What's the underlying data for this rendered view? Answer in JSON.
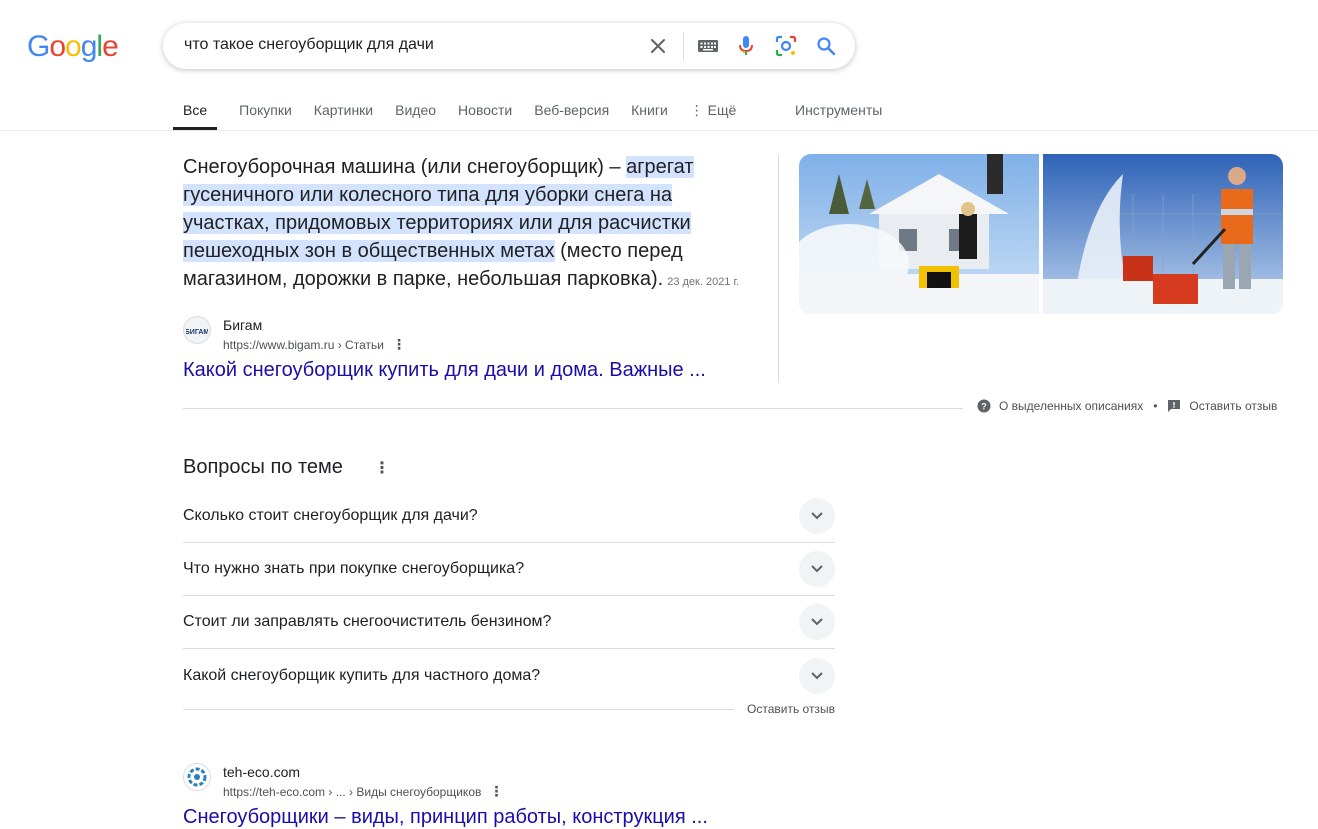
{
  "logo": {
    "letters": [
      "G",
      "o",
      "o",
      "g",
      "l",
      "e"
    ],
    "colors": [
      "#4285F4",
      "#EA4335",
      "#FBBC05",
      "#4285F4",
      "#34A853",
      "#EA4335"
    ]
  },
  "search": {
    "query": "что такое снегоуборщик для дачи",
    "icons": [
      "clear-icon",
      "keyboard-icon",
      "mic-icon",
      "lens-icon",
      "search-icon"
    ]
  },
  "tabs": {
    "items": [
      "Все",
      "Покупки",
      "Картинки",
      "Видео",
      "Новости",
      "Веб-версия",
      "Книги"
    ],
    "active": "Все",
    "more_label": "⋮ Ещё",
    "tools_label": "Инструменты"
  },
  "featured": {
    "text_before": "Снегоуборочная машина (или снегоуборщик) – ",
    "text_highlight": "агрегат гусеничного или колесного типа для уборки снега на участках, придомовых территориях или для расчистки пешеходных зон в общественных метах",
    "text_after": " (место перед магазином, дорожки в парке, небольшая парковка).",
    "date": "23 дек. 2021 г.",
    "source": {
      "favicon_text": "БИГАМ",
      "name": "Бигам",
      "url": "https://www.bigam.ru › Статьи"
    },
    "link_title": "Какой снегоуборщик купить для дачи и дома. Важные ...",
    "footer_about": "О выделенных описаниях",
    "footer_feedback": "Оставить отзыв"
  },
  "paa": {
    "title": "Вопросы по теме",
    "questions": [
      "Сколько стоит снегоуборщик для дачи?",
      "Что нужно знать при покупке снегоуборщика?",
      "Стоит ли заправлять снегоочиститель бензином?",
      "Какой снегоуборщик купить для частного дома?"
    ],
    "feedback": "Оставить отзыв"
  },
  "result2": {
    "name": "teh-eco.com",
    "url": "https://teh-eco.com › ... › Виды снегоуборщиков",
    "title": "Снегоуборщики – виды, принцип работы, конструкция ..."
  }
}
